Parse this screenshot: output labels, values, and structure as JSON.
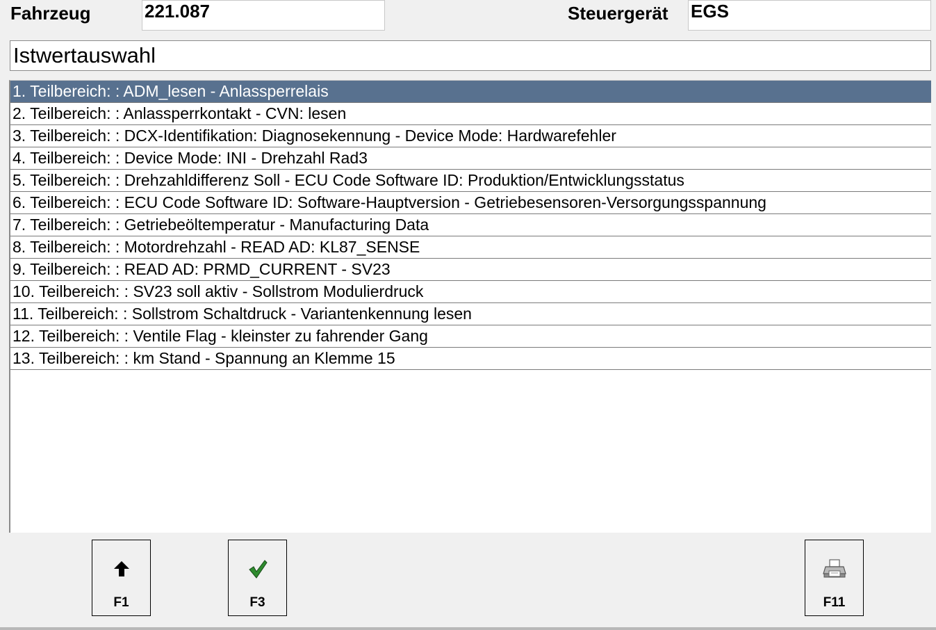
{
  "header": {
    "vehicle_label": "Fahrzeug",
    "vehicle_value": "221.087",
    "ecu_label": "Steuergerät",
    "ecu_value": "EGS"
  },
  "title": "Istwertauswahl",
  "list": {
    "selected_index": 0,
    "items": [
      "1. Teilbereich: : ADM_lesen - Anlassperrelais",
      "2. Teilbereich: : Anlassperrkontakt - CVN: lesen",
      "3. Teilbereich: : DCX-Identifikation: Diagnosekennung - Device Mode: Hardwarefehler",
      "4. Teilbereich: : Device Mode: INI - Drehzahl Rad3",
      "5. Teilbereich: : Drehzahldifferenz Soll - ECU Code Software ID: Produktion/Entwicklungsstatus",
      "6. Teilbereich: : ECU Code Software ID: Software-Hauptversion - Getriebesensoren-Versorgungsspannung",
      "7. Teilbereich: : Getriebeöltemperatur - Manufacturing Data",
      "8. Teilbereich: : Motordrehzahl - READ AD: KL87_SENSE",
      "9. Teilbereich: : READ AD: PRMD_CURRENT - SV23",
      "10. Teilbereich: : SV23 soll aktiv - Sollstrom Modulierdruck",
      "11. Teilbereich: : Sollstrom Schaltdruck - Variantenkennung lesen",
      "12. Teilbereich: : Ventile Flag - kleinster zu fahrender Gang",
      "13. Teilbereich: : km Stand - Spannung an Klemme 15"
    ]
  },
  "fkeys": {
    "f1": {
      "label": "F1",
      "icon": "arrow-up-icon"
    },
    "f3": {
      "label": "F3",
      "icon": "checkmark-icon"
    },
    "f11": {
      "label": "F11",
      "icon": "printer-icon"
    }
  },
  "colors": {
    "selection": "#58718f",
    "check": "#2e8b2e"
  }
}
